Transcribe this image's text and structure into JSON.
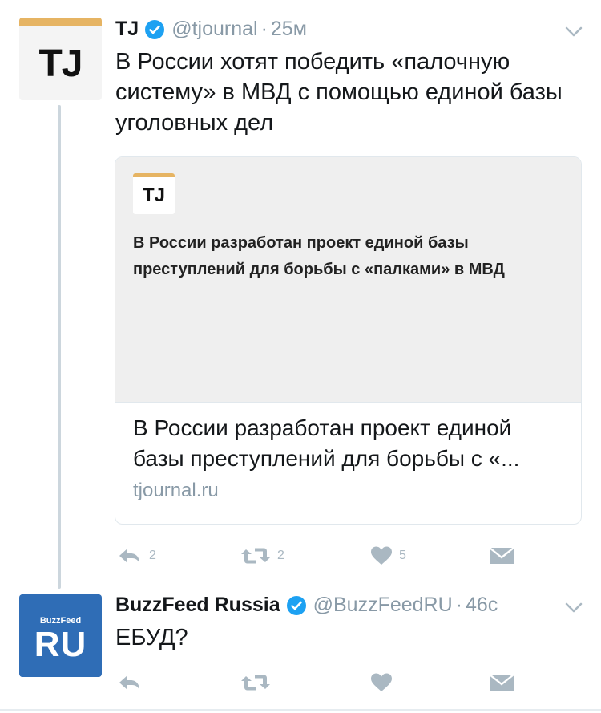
{
  "tweets": [
    {
      "avatar": {
        "monogram": "TJ",
        "accent_color": "#e6b463"
      },
      "name": "TJ",
      "handle": "@tjournal",
      "separator": "·",
      "time": "25м",
      "text": "В России хотят победить «палочную систему» в МВД с помощью единой базы уголовных дел",
      "card": {
        "logo": "TJ",
        "headline": "В России разработан проект единой базы преступлений для борьбы с «палками» в МВД",
        "title": "В России разработан проект единой базы преступлений для борьбы с «...",
        "domain": "tjournal.ru"
      },
      "actions": {
        "reply_count": "2",
        "retweet_count": "2",
        "like_count": "5"
      }
    },
    {
      "avatar": {
        "small_text": "BuzzFeed",
        "big_text": "RU",
        "bg_color": "#2f6db6"
      },
      "name": "BuzzFeed Russia",
      "handle": "@BuzzFeedRU",
      "separator": "·",
      "time": "46с",
      "text": "ЕБУД?",
      "actions": {
        "reply_count": "",
        "retweet_count": "",
        "like_count": ""
      }
    }
  ],
  "colors": {
    "verified_blue": "#1da1f2",
    "icon_gray": "#aab8c2",
    "muted_text": "#8899a6",
    "thread_line": "#ccd6dd"
  },
  "icons": [
    "verified-icon",
    "chevron-down-icon",
    "reply-icon",
    "retweet-icon",
    "heart-icon",
    "direct-message-icon"
  ]
}
